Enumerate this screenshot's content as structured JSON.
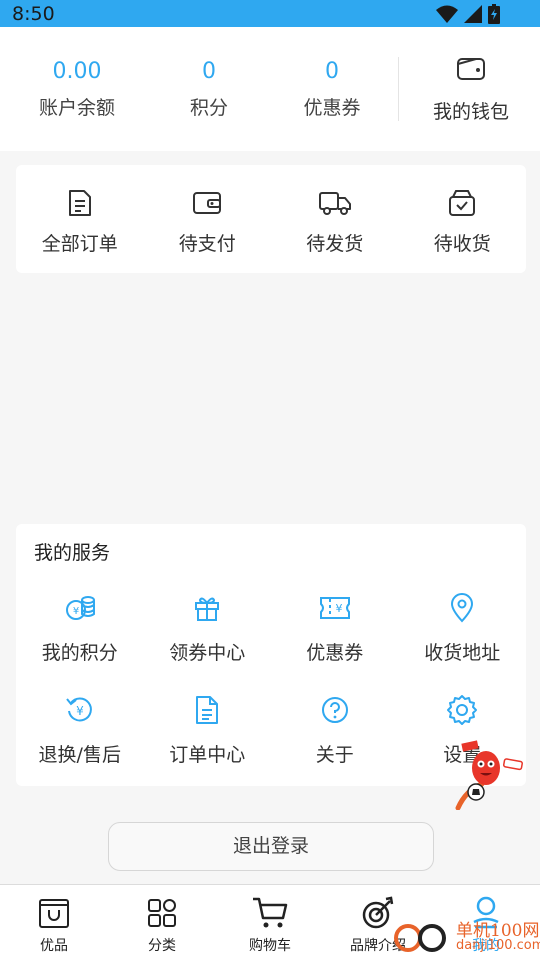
{
  "status_bar": {
    "time": "8:50"
  },
  "account": {
    "balance": {
      "value": "0.00",
      "label": "账户余额"
    },
    "points": {
      "value": "0",
      "label": "积分"
    },
    "coupons": {
      "value": "0",
      "label": "优惠券"
    },
    "wallet": {
      "label": "我的钱包",
      "icon": "wallet-icon"
    }
  },
  "orders": [
    {
      "label": "全部订单",
      "icon": "document-icon"
    },
    {
      "label": "待支付",
      "icon": "wallet-icon"
    },
    {
      "label": "待发货",
      "icon": "truck-icon"
    },
    {
      "label": "待收货",
      "icon": "box-check-icon"
    }
  ],
  "services": {
    "title": "我的服务",
    "items": [
      {
        "label": "我的积分",
        "icon": "coins-icon"
      },
      {
        "label": "领券中心",
        "icon": "gift-icon"
      },
      {
        "label": "优惠券",
        "icon": "ticket-icon"
      },
      {
        "label": "收货地址",
        "icon": "location-pin-icon"
      },
      {
        "label": "退换/售后",
        "icon": "refund-icon"
      },
      {
        "label": "订单中心",
        "icon": "document-icon"
      },
      {
        "label": "关于",
        "icon": "help-circle-icon"
      },
      {
        "label": "设置",
        "icon": "gear-icon"
      }
    ]
  },
  "logout_label": "退出登录",
  "tabbar": {
    "tabs": [
      {
        "label": "优品",
        "icon": "shopping-bag-icon"
      },
      {
        "label": "分类",
        "icon": "category-grid-icon"
      },
      {
        "label": "购物车",
        "icon": "cart-icon"
      },
      {
        "label": "品牌介绍",
        "icon": "target-icon"
      },
      {
        "label": "我的",
        "icon": "user-icon"
      }
    ],
    "active_index": 4
  },
  "watermark": {
    "text": "单机100网",
    "url": "danji100.com"
  },
  "colors": {
    "accent": "#2fa8f0",
    "background": "#f6f6f6",
    "watermark": "#e8632a"
  }
}
